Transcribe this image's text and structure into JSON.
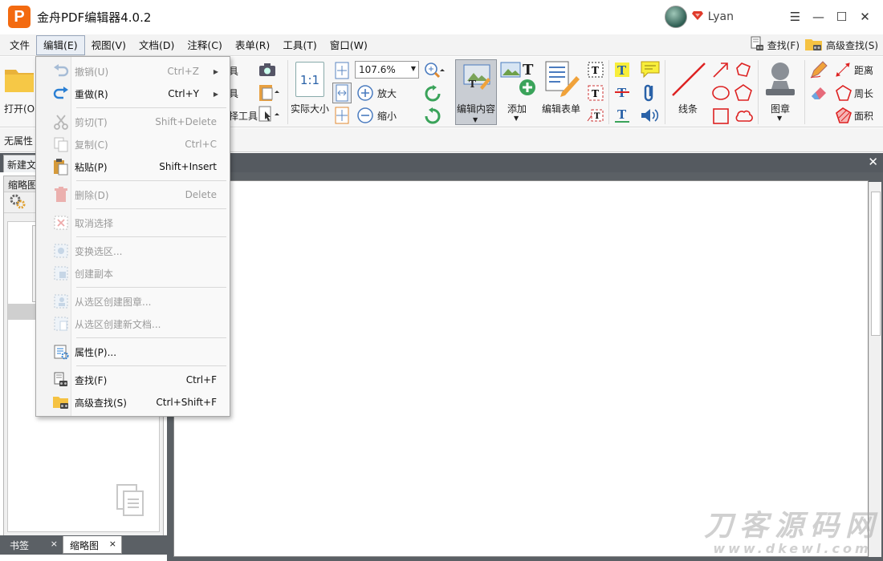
{
  "window": {
    "app_title": "金舟PDF编辑器4.0.2",
    "logo_letter": "P",
    "user_name": "Lyan",
    "controls": {
      "menu": "☰",
      "minimize": "—",
      "maximize": "☐",
      "close": "✕"
    }
  },
  "menubar": {
    "items": [
      "文件",
      "编辑(E)",
      "视图(V)",
      "文档(D)",
      "注释(C)",
      "表单(R)",
      "工具(T)",
      "窗口(W)"
    ],
    "active_index": 1,
    "find_label": "查找(F)",
    "advanced_find_label": "高级查找(S)"
  },
  "ribbon": {
    "open_label": "打开(O)",
    "partial_label_1": "具",
    "partial_label_2": "具",
    "partial_label_3": "择工具",
    "actual_size_label": "实际大小",
    "actual_size_glyph": "1:1",
    "zoom_value": "107.6%",
    "zoom_in_label": "放大",
    "zoom_out_label": "缩小",
    "edit_content_label": "编辑内容",
    "add_label": "添加",
    "edit_form_label": "编辑表单",
    "line_label": "线条",
    "stamp_label": "图章",
    "distance_label": "距离",
    "perimeter_label": "周长",
    "area_label": "面积"
  },
  "proprow": {
    "label": "无属性"
  },
  "doc_tabs": {
    "current": "新建文"
  },
  "left_panel": {
    "header": "缩略图",
    "bottom_tabs": [
      {
        "label": "书签",
        "close": "×"
      },
      {
        "label": "缩略图",
        "close": "×"
      }
    ]
  },
  "edit_menu": {
    "items": [
      {
        "label": "撤销(U)",
        "shortcut": "Ctrl+Z",
        "disabled": true,
        "submenu": true,
        "icon": "undo-icon"
      },
      {
        "label": "重做(R)",
        "shortcut": "Ctrl+Y",
        "disabled": false,
        "submenu": true,
        "icon": "redo-icon"
      },
      {
        "label": "剪切(T)",
        "shortcut": "Shift+Delete",
        "disabled": true,
        "icon": "scissors-icon"
      },
      {
        "label": "复制(C)",
        "shortcut": "Ctrl+C",
        "disabled": true,
        "icon": "copy-icon"
      },
      {
        "label": "粘贴(P)",
        "shortcut": "Shift+Insert",
        "disabled": false,
        "icon": "paste-icon"
      },
      {
        "label": "删除(D)",
        "shortcut": "Delete",
        "disabled": true,
        "icon": "trash-icon"
      },
      {
        "label": "取消选择",
        "shortcut": "",
        "disabled": true,
        "icon": "deselect-icon"
      },
      {
        "label": "变换选区...",
        "shortcut": "",
        "disabled": true,
        "icon": "transform-selection-icon"
      },
      {
        "label": "创建副本",
        "shortcut": "",
        "disabled": true,
        "icon": "duplicate-icon"
      },
      {
        "label": "从选区创建图章...",
        "shortcut": "",
        "disabled": true,
        "icon": "create-stamp-icon"
      },
      {
        "label": "从选区创建新文档...",
        "shortcut": "",
        "disabled": true,
        "icon": "create-document-icon"
      },
      {
        "label": "属性(P)...",
        "shortcut": "",
        "disabled": false,
        "icon": "properties-icon"
      },
      {
        "label": "查找(F)",
        "shortcut": "Ctrl+F",
        "disabled": false,
        "icon": "find-icon"
      },
      {
        "label": "高级查找(S)",
        "shortcut": "Ctrl+Shift+F",
        "disabled": false,
        "icon": "advanced-find-icon"
      }
    ]
  },
  "watermark": {
    "line1": "刀客源码网",
    "line2": "www.dkewl.com"
  },
  "colors": {
    "accent_orange": "#f36a10",
    "workspace_gray": "#5b6065",
    "menu_active_border": "#98a6bb",
    "disabled_text": "#9a9a9a"
  }
}
